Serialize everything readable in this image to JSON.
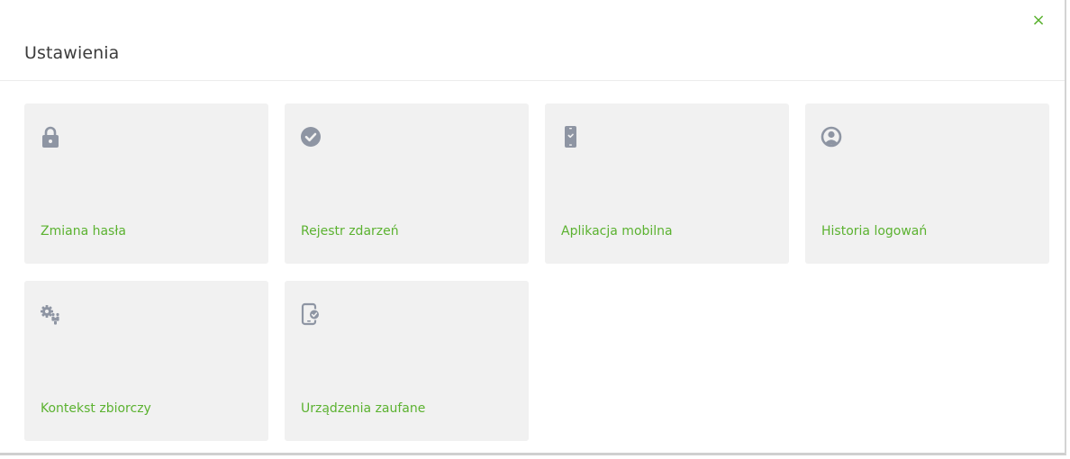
{
  "dialog": {
    "title": "Ustawienia",
    "close_label": "×"
  },
  "tiles": [
    {
      "label": "Zmiana hasła",
      "icon": "lock-icon"
    },
    {
      "label": "Rejestr zdarzeń",
      "icon": "check-circle-icon"
    },
    {
      "label": "Aplikacja mobilna",
      "icon": "mobile-phone-icon"
    },
    {
      "label": "Historia logowań",
      "icon": "user-circle-icon"
    },
    {
      "label": "Kontekst zbiorczy",
      "icon": "gears-users-icon"
    },
    {
      "label": "Urządzenia zaufane",
      "icon": "trusted-device-icon"
    }
  ],
  "colors": {
    "accent": "#5bb230",
    "tile_bg": "#f1f1f1",
    "icon": "#8e95a3"
  }
}
